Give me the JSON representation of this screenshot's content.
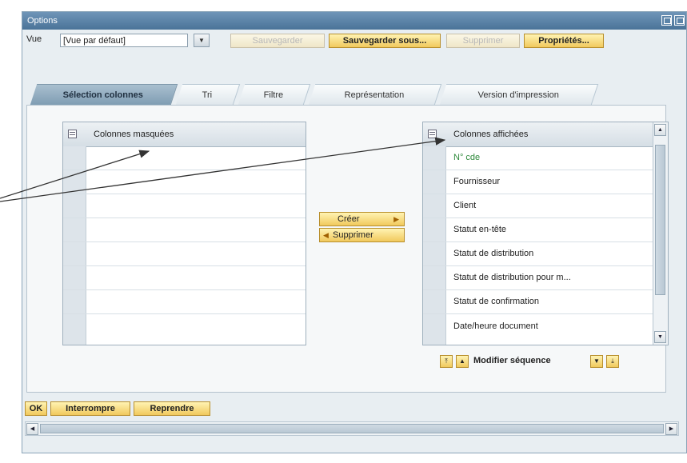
{
  "window": {
    "title": "Options"
  },
  "toolbar": {
    "view_label": "Vue",
    "view_value": "[Vue par défaut]",
    "buttons": {
      "save": "Sauvegarder",
      "save_as": "Sauvegarder sous...",
      "delete": "Supprimer",
      "properties": "Propriétés..."
    }
  },
  "tabs": [
    {
      "label": "Sélection colonnes",
      "active": true
    },
    {
      "label": "Tri",
      "active": false
    },
    {
      "label": "Filtre",
      "active": false
    },
    {
      "label": "Représentation",
      "active": false
    },
    {
      "label": "Version d'impression",
      "active": false
    }
  ],
  "hidden_columns": {
    "header": "Colonnes masquées",
    "rows": []
  },
  "shown_columns": {
    "header": "Colonnes affichées",
    "rows": [
      "N° cde",
      "Fournisseur",
      "Client",
      "Statut en-tête",
      "Statut de distribution",
      "Statut de distribution pour m...",
      "Statut de confirmation",
      "Date/heure document"
    ]
  },
  "transfer": {
    "create": "Créer",
    "remove": "Supprimer"
  },
  "sequence": {
    "label": "Modifier séquence"
  },
  "footer": {
    "ok": "OK",
    "cancel": "Interrompre",
    "apply": "Reprendre"
  },
  "colors": {
    "accent_button": "#f1c95d",
    "titlebar": "#4a7398",
    "highlight_text": "#2f8a3c"
  }
}
